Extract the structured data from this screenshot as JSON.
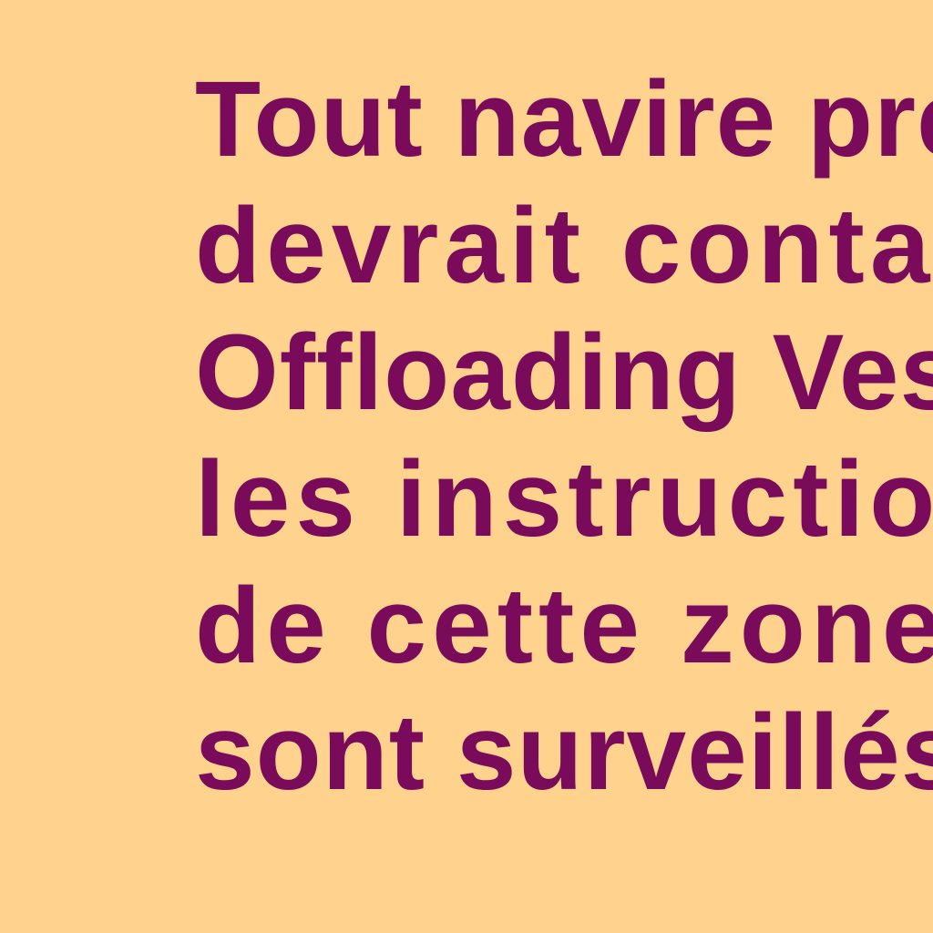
{
  "map_note": {
    "lines": [
      "Tout navire pré",
      "devrait conta",
      "Offloading Vess",
      "les instructions",
      "de cette zone. ",
      "sont surveillés"
    ]
  },
  "colors": {
    "background": "#ffd38d",
    "text": "#7a0a5a"
  }
}
